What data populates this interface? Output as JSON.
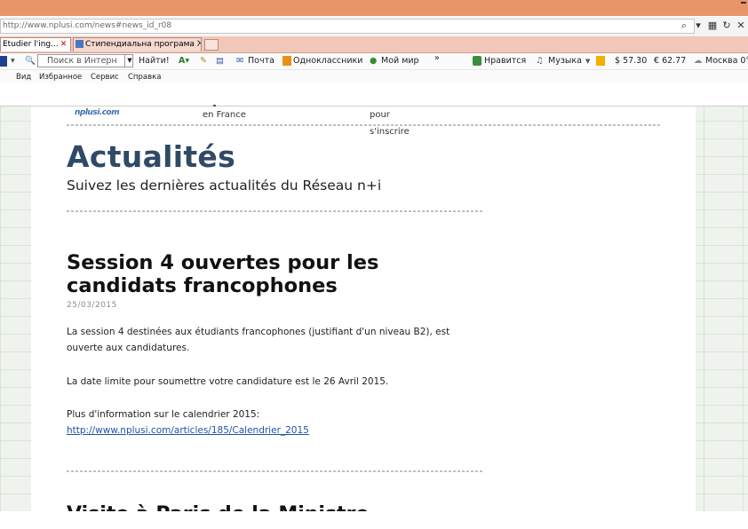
{
  "browser": {
    "url": "http://www.nplusi.com/news#news_id_r08",
    "tabs": [
      {
        "label": "Etudier l'ing...",
        "active": true
      },
      {
        "label": "Стипендиальна програма Жа...",
        "active": false
      }
    ]
  },
  "toolbar": {
    "search_placeholder": "Поиск в Интерн",
    "find_label": "Найти!",
    "mail_label": "Почта",
    "ok_label": "Одноклассники",
    "moimir_label": "Мой мир",
    "more_label": "»",
    "like_label": "Нравится",
    "music_label": "Музыка",
    "usd_rate": "$ 57.30",
    "eur_rate": "€ 62.77",
    "weather_label": "Москва 0°"
  },
  "menubar": {
    "items": [
      "Вид",
      "Избранное",
      "Сервис",
      "Справка"
    ]
  },
  "site_header": {
    "logo_text": "nplusi.com",
    "col1_text": "en France",
    "col2_line1": "pour",
    "col2_line2": "s'inscrire"
  },
  "page": {
    "title": "Actualités",
    "subtitle": "Suivez les dernières actualités du Réseau n+i"
  },
  "article": {
    "title": "Session 4 ouvertes pour les candidats francophones",
    "date": "25/03/2015",
    "para1": "La session 4 destinées aux étudiants francophones (justifiant d'un niveau B2), est ouverte aux candidatures.",
    "para2": "La date limite pour soumettre votre candidature est le 26 Avril 2015.",
    "para3_prefix": "Plus d'information sur le calendrier 2015: ",
    "para3_link": "http://www.nplusi.com/articles/185/Calendrier_2015"
  },
  "next_article": {
    "title_fragment": "Visite à Paris de la Ministre...."
  }
}
